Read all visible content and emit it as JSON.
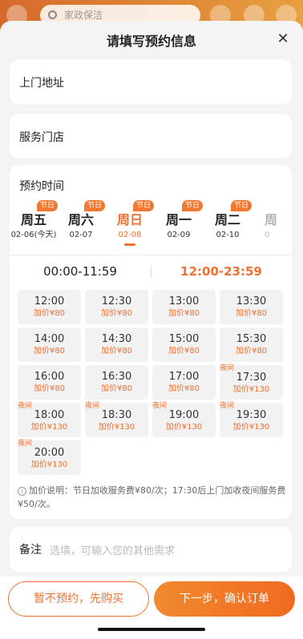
{
  "background": {
    "search_placeholder": "家政保洁"
  },
  "sheet": {
    "title": "请填写预约信息",
    "close_icon": "close-icon"
  },
  "address": {
    "label": "上门地址"
  },
  "store": {
    "label": "服务门店"
  },
  "schedule": {
    "label": "预约时间",
    "days": [
      {
        "week": "周五",
        "date": "02-06(今天)",
        "badge": "节日",
        "active": false
      },
      {
        "week": "周六",
        "date": "02-07",
        "badge": "节日",
        "active": false
      },
      {
        "week": "周日",
        "date": "02-08",
        "badge": "节日",
        "active": true
      },
      {
        "week": "周一",
        "date": "02-09",
        "badge": "节日",
        "active": false
      },
      {
        "week": "周二",
        "date": "02-10",
        "badge": "节日",
        "active": false
      },
      {
        "week": "周",
        "date": "0",
        "badge": "",
        "active": false
      }
    ],
    "ranges": [
      {
        "label": "00:00-11:59",
        "active": false
      },
      {
        "label": "12:00-23:59",
        "active": true
      }
    ],
    "night_tag": "夜间",
    "slots": [
      {
        "time": "12:00",
        "price": "加价¥80",
        "night": false
      },
      {
        "time": "12:30",
        "price": "加价¥80",
        "night": false
      },
      {
        "time": "13:00",
        "price": "加价¥80",
        "night": false
      },
      {
        "time": "13:30",
        "price": "加价¥80",
        "night": false
      },
      {
        "time": "14:00",
        "price": "加价¥80",
        "night": false
      },
      {
        "time": "14:30",
        "price": "加价¥80",
        "night": false
      },
      {
        "time": "15:00",
        "price": "加价¥80",
        "night": false
      },
      {
        "time": "15:30",
        "price": "加价¥80",
        "night": false
      },
      {
        "time": "16:00",
        "price": "加价¥80",
        "night": false
      },
      {
        "time": "16:30",
        "price": "加价¥80",
        "night": false
      },
      {
        "time": "17:00",
        "price": "加价¥80",
        "night": false
      },
      {
        "time": "17:30",
        "price": "加价¥130",
        "night": true
      },
      {
        "time": "18:00",
        "price": "加价¥130",
        "night": true
      },
      {
        "time": "18:30",
        "price": "加价¥130",
        "night": true
      },
      {
        "time": "19:00",
        "price": "加价¥130",
        "night": true
      },
      {
        "time": "19:30",
        "price": "加价¥130",
        "night": true
      },
      {
        "time": "20:00",
        "price": "加价¥130",
        "night": true
      }
    ],
    "note": "加价说明：节日加收服务费¥80/次；17:30后上门加收夜间服务费¥50/次。"
  },
  "remark": {
    "label": "备注",
    "placeholder": "选填，可输入您的其他需求"
  },
  "actions": {
    "secondary": "暂不预约，先购买",
    "primary": "下一步，确认订单"
  },
  "colors": {
    "accent": "#f07030",
    "badge": "#f07830"
  }
}
